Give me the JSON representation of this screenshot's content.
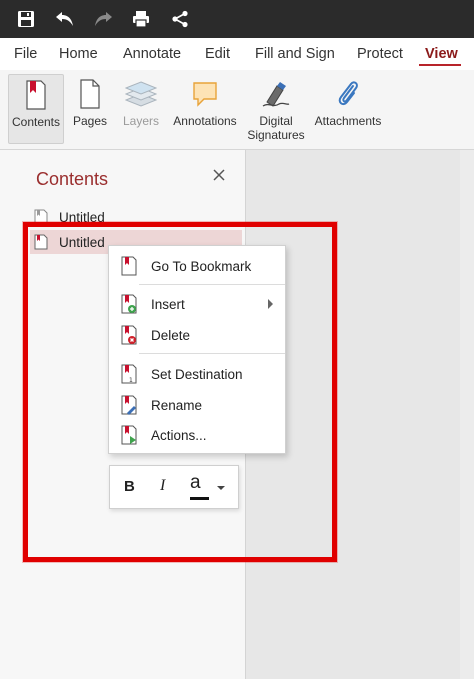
{
  "quick_access": {
    "icons": [
      "save-icon",
      "undo-icon",
      "redo-icon",
      "print-icon",
      "share-icon"
    ]
  },
  "menu": {
    "items": [
      "File",
      "Home",
      "Annotate",
      "Edit",
      "Fill and Sign",
      "Protect",
      "View"
    ],
    "active": "View"
  },
  "ribbon": {
    "items": [
      {
        "label": "Contents",
        "icon": "bookmark-icon",
        "selected": true
      },
      {
        "label": "Pages",
        "icon": "page-icon"
      },
      {
        "label": "Layers",
        "icon": "layers-icon",
        "disabled": true
      },
      {
        "label": "Annotations",
        "icon": "comment-icon"
      },
      {
        "label": "Digital\nSignatures",
        "label_line1": "Digital",
        "label_line2": "Signatures",
        "icon": "signature-pen-icon"
      },
      {
        "label": "Attachments",
        "icon": "paperclip-icon"
      }
    ]
  },
  "panel": {
    "title": "Contents",
    "bookmarks": [
      {
        "label": "Untitled",
        "selected": false
      },
      {
        "label": "Untitled",
        "selected": true
      }
    ]
  },
  "context_menu": {
    "items": [
      {
        "label": "Go To Bookmark",
        "icon": "go-to-bookmark-icon"
      },
      {
        "label": "Insert",
        "icon": "insert-bookmark-icon",
        "submenu": true
      },
      {
        "label": "Delete",
        "icon": "delete-bookmark-icon"
      },
      {
        "label": "Set Destination",
        "icon": "set-destination-icon"
      },
      {
        "label": "Rename",
        "icon": "rename-bookmark-icon"
      },
      {
        "label": "Actions...",
        "icon": "bookmark-actions-icon"
      }
    ]
  },
  "format_toolbar": {
    "bold": "B",
    "italic": "I",
    "color": "a"
  },
  "colors": {
    "accent": "#b8242a",
    "highlight": "#e00000",
    "bookmark_red": "#c8102e"
  }
}
